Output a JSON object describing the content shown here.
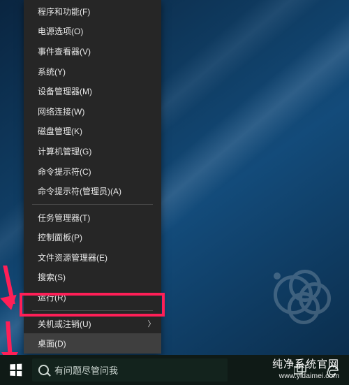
{
  "menu": {
    "group1": [
      "程序和功能(F)",
      "电源选项(O)",
      "事件查看器(V)",
      "系统(Y)",
      "设备管理器(M)",
      "网络连接(W)",
      "磁盘管理(K)",
      "计算机管理(G)",
      "命令提示符(C)",
      "命令提示符(管理员)(A)"
    ],
    "group2": [
      "任务管理器(T)",
      "控制面板(P)",
      "文件资源管理器(E)",
      "搜索(S)",
      "运行(R)"
    ],
    "group3": [
      {
        "label": "关机或注销(U)",
        "submenu": true,
        "selected": false
      },
      {
        "label": "桌面(D)",
        "submenu": false,
        "selected": true
      }
    ]
  },
  "taskbar": {
    "search_placeholder": "有问题尽管问我"
  },
  "watermark": {
    "title": "纯净系统官网",
    "url": "www.yidaimei.com"
  }
}
